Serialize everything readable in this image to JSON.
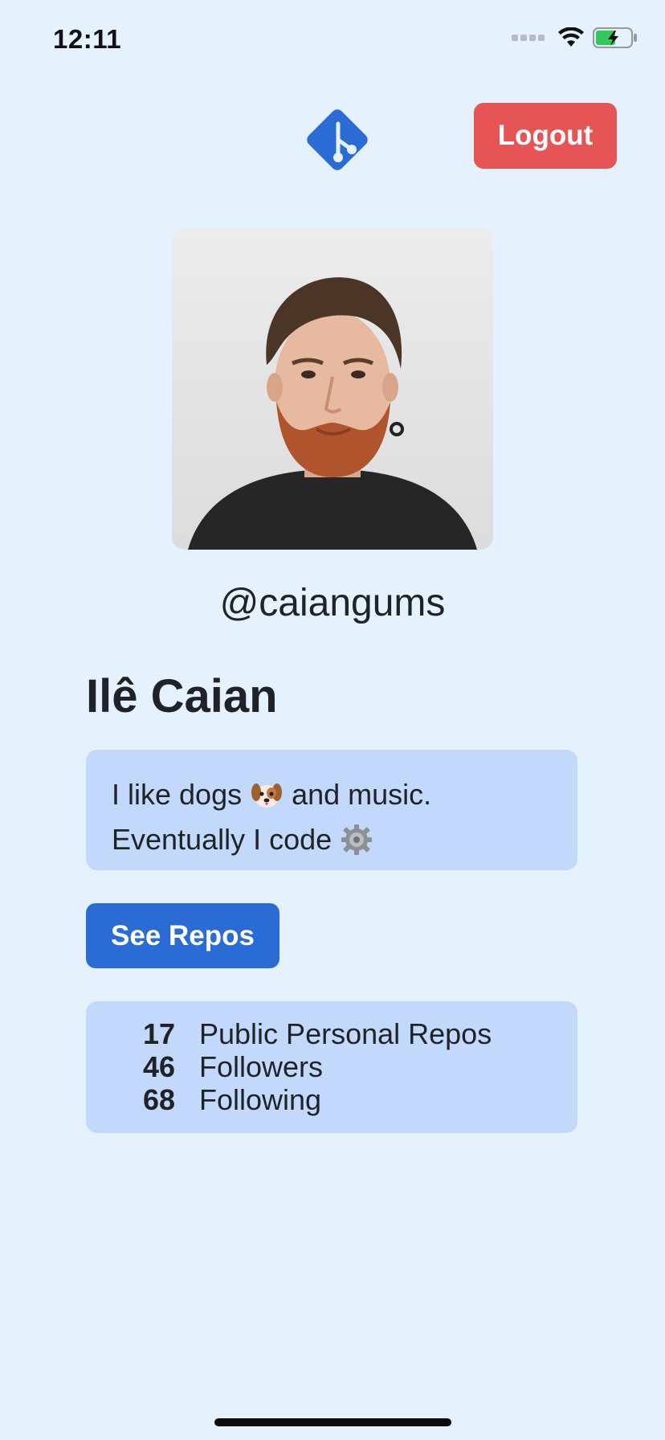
{
  "status_bar": {
    "time": "12:11"
  },
  "header": {
    "logo_icon": "git-branch-logo-icon",
    "logout_label": "Logout",
    "logout_color": "#e65555"
  },
  "profile": {
    "avatar_alt": "profile-photo",
    "username": "@caiangums",
    "full_name": "Ilê Caian",
    "bio": {
      "line1_before": "I like dogs",
      "line1_emoji": "dog-face-icon",
      "line1_after": "and music.",
      "line2_before": "Eventually I code",
      "line2_emoji": "gear-icon"
    }
  },
  "actions": {
    "see_repos_label": "See Repos",
    "see_repos_color": "#2b6bd6"
  },
  "stats": [
    {
      "value": "17",
      "label": "Public Personal Repos"
    },
    {
      "value": "46",
      "label": "Followers"
    },
    {
      "value": "68",
      "label": "Following"
    }
  ],
  "colors": {
    "background": "#e5f1fd",
    "card": "#c2d9fb",
    "text": "#1f2328"
  }
}
